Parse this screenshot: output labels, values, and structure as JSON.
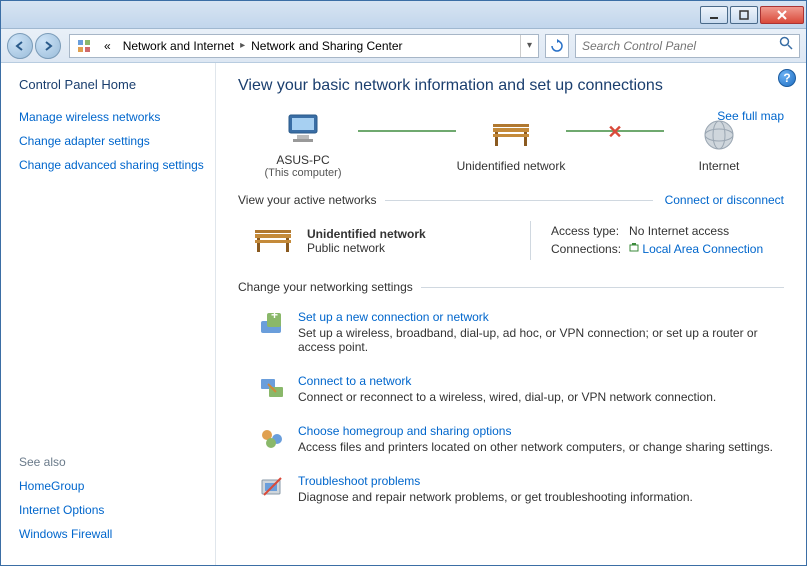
{
  "breadcrumb": {
    "prefix": "«",
    "seg1": "Network and Internet",
    "seg2": "Network and Sharing Center"
  },
  "search": {
    "placeholder": "Search Control Panel"
  },
  "sidebar": {
    "home": "Control Panel Home",
    "links": [
      "Manage wireless networks",
      "Change adapter settings",
      "Change advanced sharing settings"
    ],
    "see_also_label": "See also",
    "see_also": [
      "HomeGroup",
      "Internet Options",
      "Windows Firewall"
    ]
  },
  "page": {
    "title": "View your basic network information and set up connections",
    "see_full_map": "See full map",
    "map": {
      "node1": "ASUS-PC",
      "node1_sub": "(This computer)",
      "node2": "Unidentified network",
      "node3": "Internet"
    },
    "active_section": "View your active networks",
    "connect_disconnect": "Connect or disconnect",
    "active": {
      "name": "Unidentified network",
      "type": "Public network",
      "access_label": "Access type:",
      "access_value": "No Internet access",
      "conn_label": "Connections:",
      "conn_value": "Local Area Connection"
    },
    "change_section": "Change your networking settings",
    "settings": [
      {
        "title": "Set up a new connection or network",
        "desc": "Set up a wireless, broadband, dial-up, ad hoc, or VPN connection; or set up a router or access point."
      },
      {
        "title": "Connect to a network",
        "desc": "Connect or reconnect to a wireless, wired, dial-up, or VPN network connection."
      },
      {
        "title": "Choose homegroup and sharing options",
        "desc": "Access files and printers located on other network computers, or change sharing settings."
      },
      {
        "title": "Troubleshoot problems",
        "desc": "Diagnose and repair network problems, or get troubleshooting information."
      }
    ]
  }
}
